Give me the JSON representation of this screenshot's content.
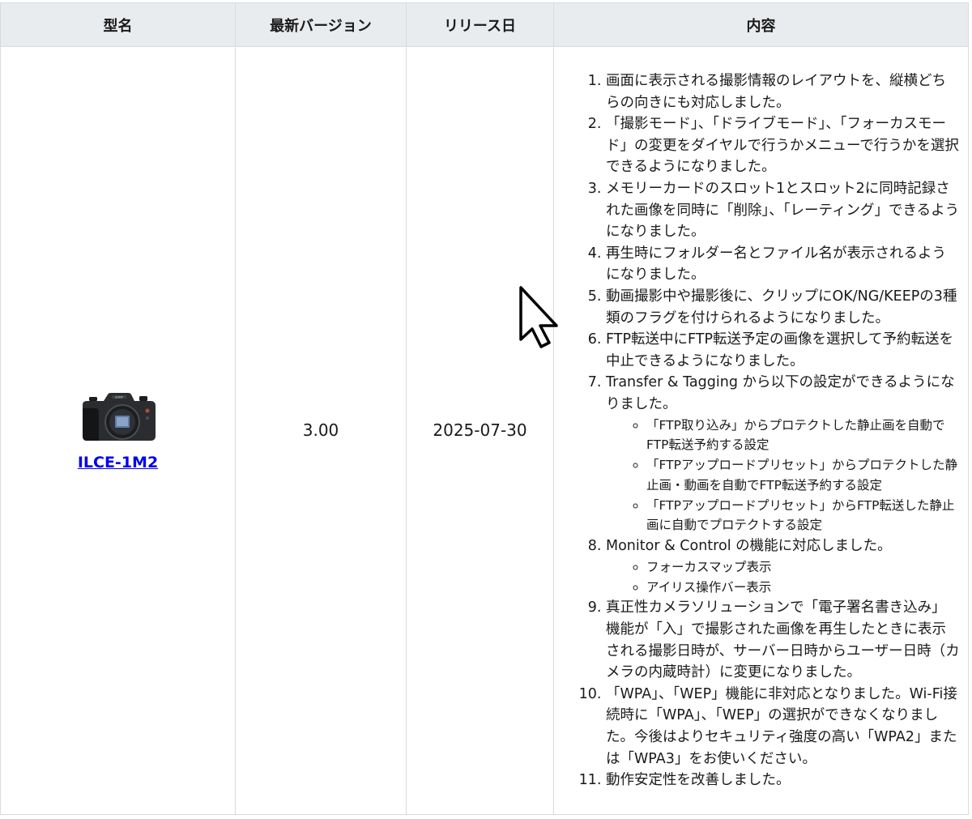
{
  "table": {
    "headers": {
      "model": "型名",
      "version": "最新バージョン",
      "release_date": "リリース日",
      "content": "内容"
    },
    "row": {
      "model": "ILCE-1M2",
      "version": "3.00",
      "release_date": "2025-07-30",
      "changes": [
        "画面に表示される撮影情報のレイアウトを、縦横どちらの向きにも対応しました。",
        "「撮影モード」、「ドライブモード」、「フォーカスモード」の変更をダイヤルで行うかメニューで行うかを選択できるようになりました。",
        "メモリーカードのスロット1とスロット2に同時記録された画像を同時に「削除」、「レーティング」できるようになりました。",
        "再生時にフォルダー名とファイル名が表示されるようになりました。",
        "動画撮影中や撮影後に、クリップにOK/NG/KEEPの3種類のフラグを付けられるようになりました。",
        "FTP転送中にFTP転送予定の画像を選択して予約転送を中止できるようになりました。",
        "Transfer & Tagging から以下の設定ができるようになりました。",
        "Monitor & Control の機能に対応しました。",
        "真正性カメラソリューションで「電子署名書き込み」機能が「入」で撮影された画像を再生したときに表示される撮影日時が、サーバー日時からユーザー日時（カメラの内蔵時計）に変更になりました。",
        "「WPA」、「WEP」機能に非対応となりました。Wi-Fi接続時に「WPA」、「WEP」の選択ができなくなりました。今後はよりセキュリティ強度の高い「WPA2」または「WPA3」をお使いください。",
        "動作安定性を改善しました。"
      ],
      "sub_changes_7": [
        "「FTP取り込み」からプロテクトした静止画を自動でFTP転送予約する設定",
        "「FTPアップロードプリセット」からプロテクトした静止画・動画を自動でFTP転送予約する設定",
        "「FTPアップロードプリセット」からFTP転送した静止画に自動でプロテクトする設定"
      ],
      "sub_changes_8": [
        "フォーカスマップ表示",
        "アイリス操作バー表示"
      ]
    }
  },
  "icons": {
    "camera": "camera-body-icon",
    "cursor": "mouse-pointer-icon"
  },
  "colors": {
    "header_bg": "#e9ecef",
    "border": "#d7dbe0",
    "link": "#0000ee"
  }
}
